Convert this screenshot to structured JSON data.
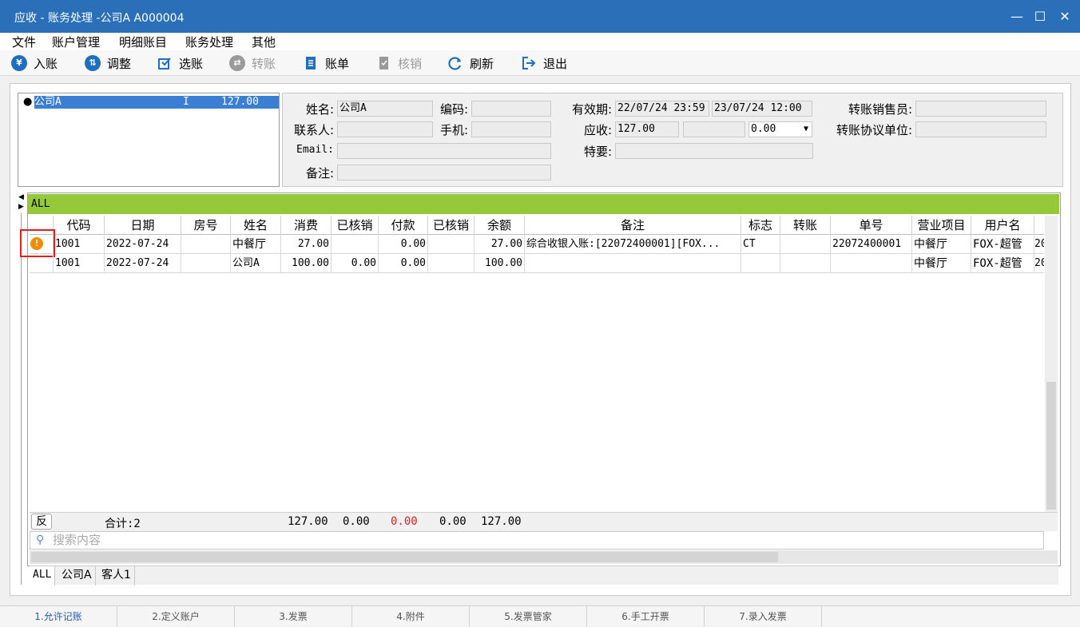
{
  "window": {
    "title": "应收 - 账务处理 -公司A  A000004"
  },
  "menu": [
    "文件",
    "账户管理",
    "明细账目",
    "账务处理",
    "其他"
  ],
  "toolbar": {
    "post": "入账",
    "adjust": "调整",
    "select": "选账",
    "transfer": "转账",
    "statement": "账单",
    "writeoff": "核销",
    "refresh": "刷新",
    "exit": "退出"
  },
  "account_list": {
    "name": "公司A",
    "type": "I",
    "amount": "127.00"
  },
  "info": {
    "name_label": "姓名:",
    "name_value": "公司A",
    "code_label": "编码:",
    "code_value": "",
    "valid_label": "有效期:",
    "valid_from": "22/07/24 23:59",
    "valid_to": "23/07/24 12:00",
    "sales_label": "转账销售员:",
    "sales_value": "",
    "contact_label": "联系人:",
    "contact_value": "",
    "mobile_label": "手机:",
    "mobile_value": "",
    "receivable_label": "应收:",
    "receivable_value": "127.00",
    "receivable_mid": "",
    "receivable_sel": "0.00",
    "agreement_label": "转账协议单位:",
    "agreement_value": "",
    "email_label": "Email:",
    "email_value": "",
    "special_label": "特要:",
    "special_value": "",
    "note_label": "备注:",
    "note_value": ""
  },
  "grid": {
    "group": "ALL",
    "columns": [
      "代码",
      "日期",
      "房号",
      "姓名",
      "消费",
      "已核销",
      "付款",
      "已核销",
      "余额",
      "备注",
      "标志",
      "转账",
      "单号",
      "营业项目",
      "用户名"
    ],
    "rows": [
      [
        "1001",
        "2022-07-24",
        "",
        "中餐厅",
        "27.00",
        "",
        "0.00",
        "",
        "27.00",
        "综合收银入账:[22072400001][FOX...",
        "CT",
        "",
        "22072400001",
        "中餐厅",
        "FOX-超管",
        "20"
      ],
      [
        "1001",
        "2022-07-24",
        "",
        "公司A",
        "100.00",
        "0.00",
        "0.00",
        "",
        "100.00",
        "",
        "",
        "",
        "",
        "中餐厅",
        "FOX-超管",
        "20"
      ]
    ],
    "summary": {
      "reverse": "反",
      "total": "合计:2",
      "consume": "127.00",
      "written1": "0.00",
      "payment": "0.00",
      "written2": "0.00",
      "balance": "127.00"
    },
    "search_placeholder": "搜索内容",
    "tabs": [
      "ALL",
      "公司A",
      "客人1"
    ]
  },
  "statusbar": [
    "1.允许记账",
    "2.定义账户",
    "3.发票",
    "4.附件",
    "5.发票管家",
    "6.手工开票",
    "7.录入发票"
  ],
  "colors": {
    "title": "#2a6fb8",
    "group": "#95c93a",
    "negative": "#e02020",
    "warning": "#f08c00"
  }
}
